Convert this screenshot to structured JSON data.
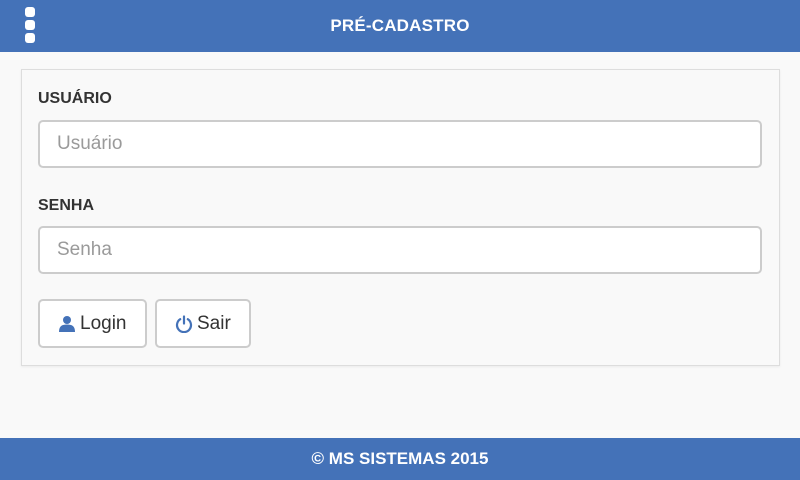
{
  "header": {
    "title": "PRÉ-CADASTRO",
    "menu_icon": "vertical-dots-menu-icon"
  },
  "form": {
    "username": {
      "label": "USUÁRIO",
      "placeholder": "Usuário",
      "value": ""
    },
    "password": {
      "label": "SENHA",
      "placeholder": "Senha",
      "value": ""
    },
    "login_button": {
      "label": "Login",
      "icon": "user-icon"
    },
    "exit_button": {
      "label": "Sair",
      "icon": "power-icon"
    }
  },
  "footer": {
    "text": "© MS SISTEMAS 2015"
  },
  "colors": {
    "brand": "#4472b8",
    "icon": "#4472b8",
    "background": "#f9f9f9"
  }
}
